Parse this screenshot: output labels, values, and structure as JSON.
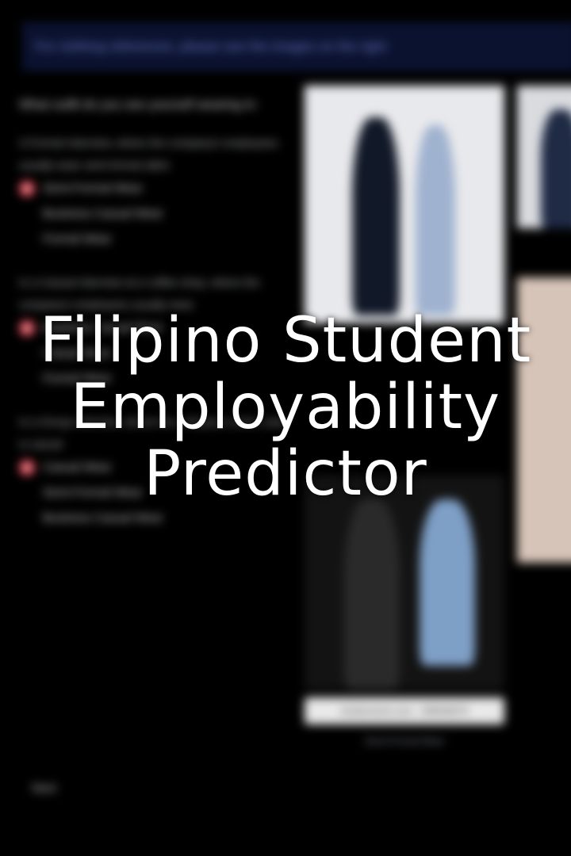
{
  "title_lines": [
    "Filipino Student",
    "Employability",
    "Predictor"
  ],
  "background": {
    "banner": "For clothing references, please see the images on the right",
    "question_title": "What outfit do you see yourself wearing in:",
    "questions": [
      {
        "prompt": "A Formal Interview, where the company's employees usually wear semi-formal attire",
        "options": [
          "Semi-Formal Wear",
          "Business Casual Wear",
          "Formal Wear"
        ],
        "selected": 0
      },
      {
        "prompt": "In a Casual Interview at a coffee shop, where the company's employees usually wear",
        "options": [
          "Business Casual Wear",
          "Casual Wear",
          "Formal Wear"
        ],
        "selected": 0
      },
      {
        "prompt": "In a Group Interview, where the company's dress code is casual",
        "options": [
          "Casual Wear",
          "Semi-Formal Wear",
          "Business Casual Wear"
        ],
        "selected": 0
      }
    ],
    "image_watermark": "shutterstock.com · 399568976",
    "image_caption": "Semi-Formal Wear",
    "next_label": "Next"
  },
  "colors": {
    "radio_selected": "#e13b4a",
    "banner_bg": "#0b1230"
  }
}
